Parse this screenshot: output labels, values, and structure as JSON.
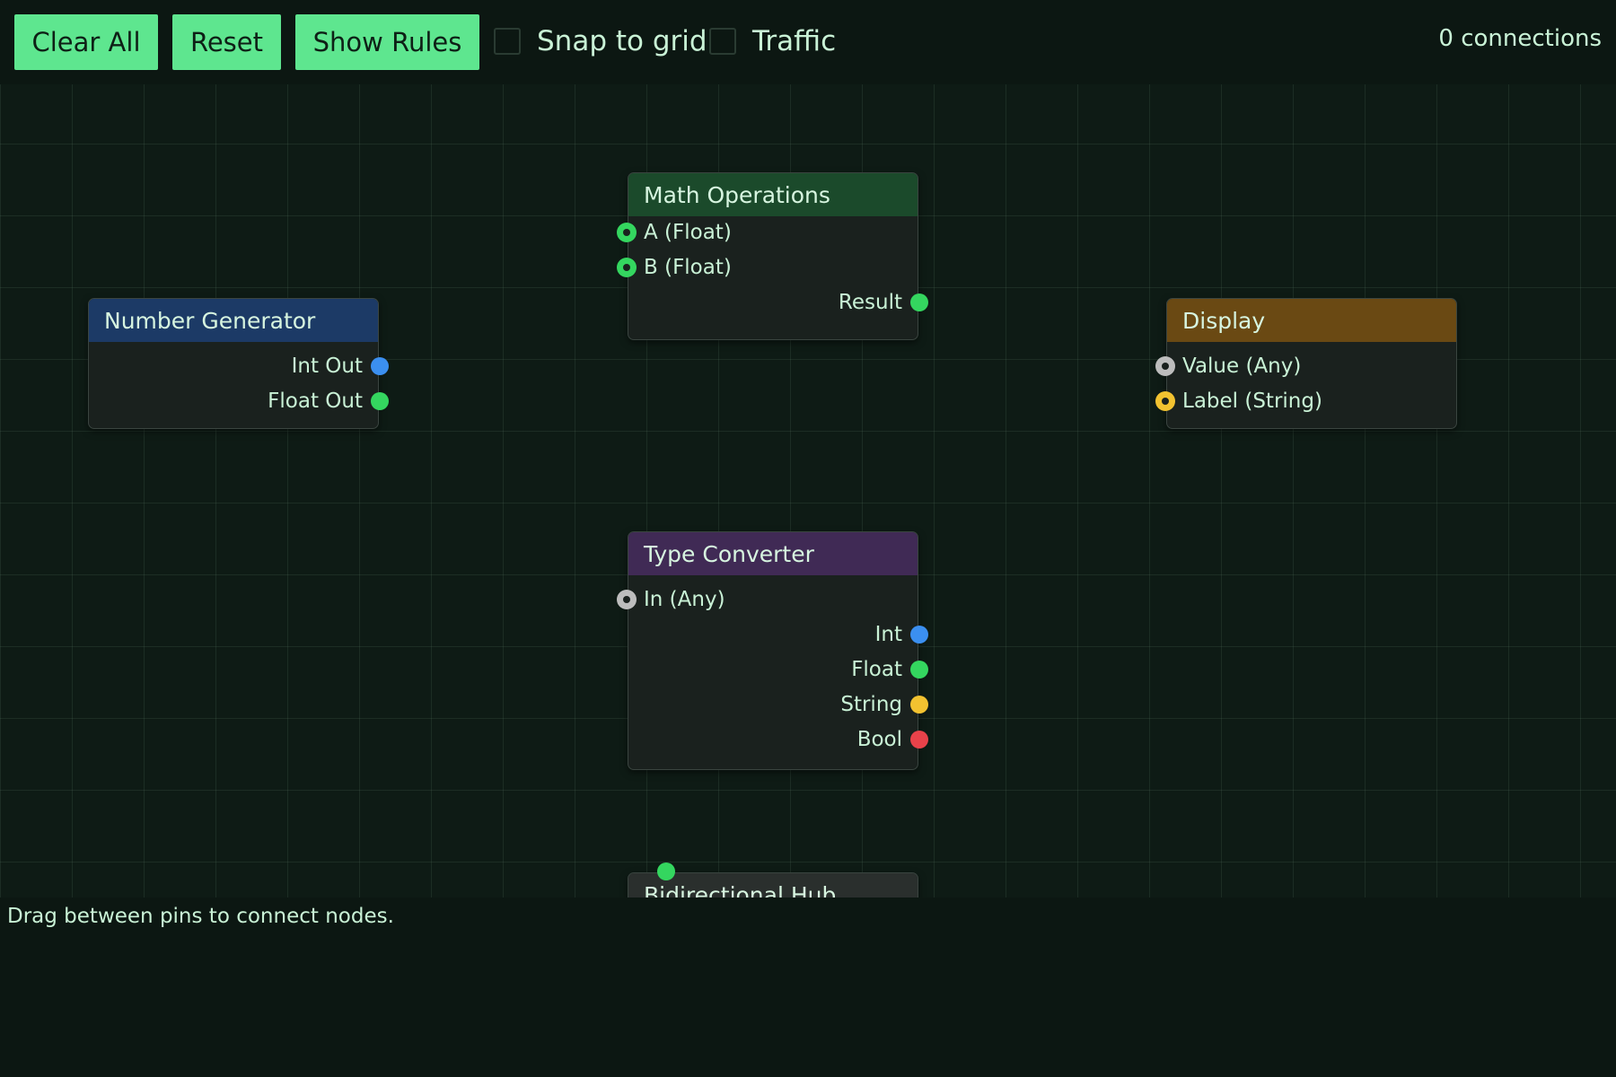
{
  "toolbar": {
    "clear_all": "Clear All",
    "reset": "Reset",
    "show_rules": "Show Rules",
    "snap_to_grid": "Snap to grid",
    "traffic": "Traffic",
    "snap_checked": false,
    "traffic_checked": false
  },
  "connections_label": "0 connections",
  "status": "Drag between pins to connect nodes.",
  "pin_colors": {
    "int": "#3b8ff0",
    "float": "#34d65f",
    "string": "#f2c230",
    "bool": "#e8424a",
    "any": "#bdbdbd"
  },
  "nodes": {
    "math": {
      "title": "Math Operations",
      "header_color": "#1b4a2b",
      "inputs": [
        "A (Float)",
        "B (Float)"
      ],
      "outputs": [
        "Result"
      ]
    },
    "number": {
      "title": "Number Generator",
      "header_color": "#1c3a66",
      "outputs": [
        "Int Out",
        "Float Out"
      ]
    },
    "display": {
      "title": "Display",
      "header_color": "#6a4913",
      "inputs": [
        "Value (Any)",
        "Label (String)"
      ]
    },
    "converter": {
      "title": "Type Converter",
      "header_color": "#402a55",
      "inputs": [
        "In (Any)"
      ],
      "outputs": [
        "Int",
        "Float",
        "String",
        "Bool"
      ]
    },
    "hub": {
      "title": "Bidirectional Hub",
      "header_color": "#2a2f2d"
    }
  }
}
